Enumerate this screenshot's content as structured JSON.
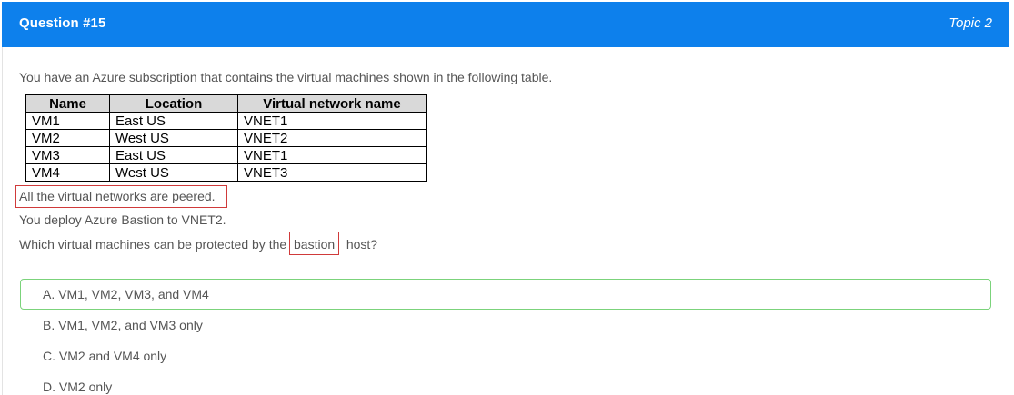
{
  "header": {
    "question_number": "Question #15",
    "topic": "Topic 2",
    "background_color": "#0d80ec"
  },
  "question": {
    "intro": "You have an Azure subscription that contains the virtual machines shown in the following table.",
    "table": {
      "headers": [
        "Name",
        "Location",
        "Virtual network name"
      ],
      "rows": [
        [
          "VM1",
          "East US",
          "VNET1"
        ],
        [
          "VM2",
          "West US",
          "VNET2"
        ],
        [
          "VM3",
          "East US",
          "VNET1"
        ],
        [
          "VM4",
          "West US",
          "VNET3"
        ]
      ]
    },
    "statement_peered": "All the virtual networks are peered.",
    "statement_deploy": "You deploy Azure Bastion to VNET2.",
    "prompt_before": "Which virtual machines can be protected by the",
    "prompt_highlight": "bastion",
    "prompt_after": "host?",
    "highlight_color": "#d03a3a"
  },
  "options": [
    {
      "label": "A. VM1, VM2, VM3, and VM4",
      "selected": true
    },
    {
      "label": "B. VM1, VM2, and VM3 only",
      "selected": false
    },
    {
      "label": "C. VM2 and VM4 only",
      "selected": false
    },
    {
      "label": "D. VM2 only",
      "selected": false
    }
  ],
  "selected_border_color": "#7bd37b"
}
